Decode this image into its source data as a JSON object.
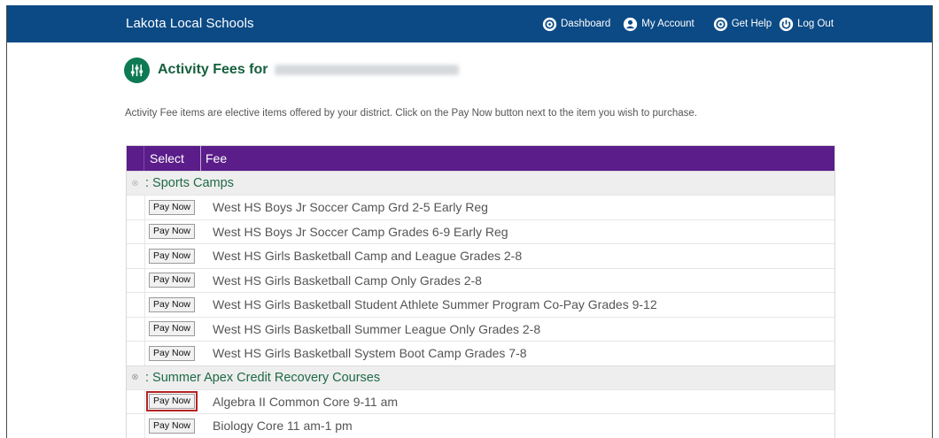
{
  "header": {
    "brand": "Lakota Local Schools",
    "nav": [
      {
        "label": "Dashboard",
        "icon": "dashboard-icon"
      },
      {
        "label": "My Account",
        "icon": "user-icon"
      },
      {
        "label": "Get Help",
        "icon": "help-icon"
      },
      {
        "label": "Log Out",
        "icon": "power-icon"
      }
    ]
  },
  "page": {
    "title": "Activity Fees for",
    "description": "Activity Fee items are elective items offered by your district. Click on the Pay Now button next to the item you wish to purchase."
  },
  "table": {
    "col_select": "Select",
    "col_fee": "Fee",
    "pay_label": "Pay Now",
    "groups": [
      {
        "label": ": Sports Camps",
        "items": [
          "West HS Boys Jr Soccer Camp Grd 2-5 Early Reg",
          "West HS Boys Jr Soccer Camp Grades 6-9 Early Reg",
          "West HS Girls Basketball Camp and League Grades 2-8",
          "West HS Girls Basketball Camp Only Grades 2-8",
          "West HS Girls Basketball Student Athlete Summer Program Co-Pay Grades 9-12",
          "West HS Girls Basketball Summer League Only Grades 2-8",
          "West HS Girls Basketball System Boot Camp Grades 7-8"
        ]
      },
      {
        "label": ": Summer Apex Credit Recovery Courses",
        "items": [
          "Algebra II Common Core 9-11 am",
          "Biology Core 11 am-1 pm"
        ]
      }
    ]
  },
  "colors": {
    "header_bg": "#0b4a85",
    "table_header_bg": "#5a1d8a",
    "accent_green": "#16603e",
    "highlight_red": "#b42323"
  }
}
